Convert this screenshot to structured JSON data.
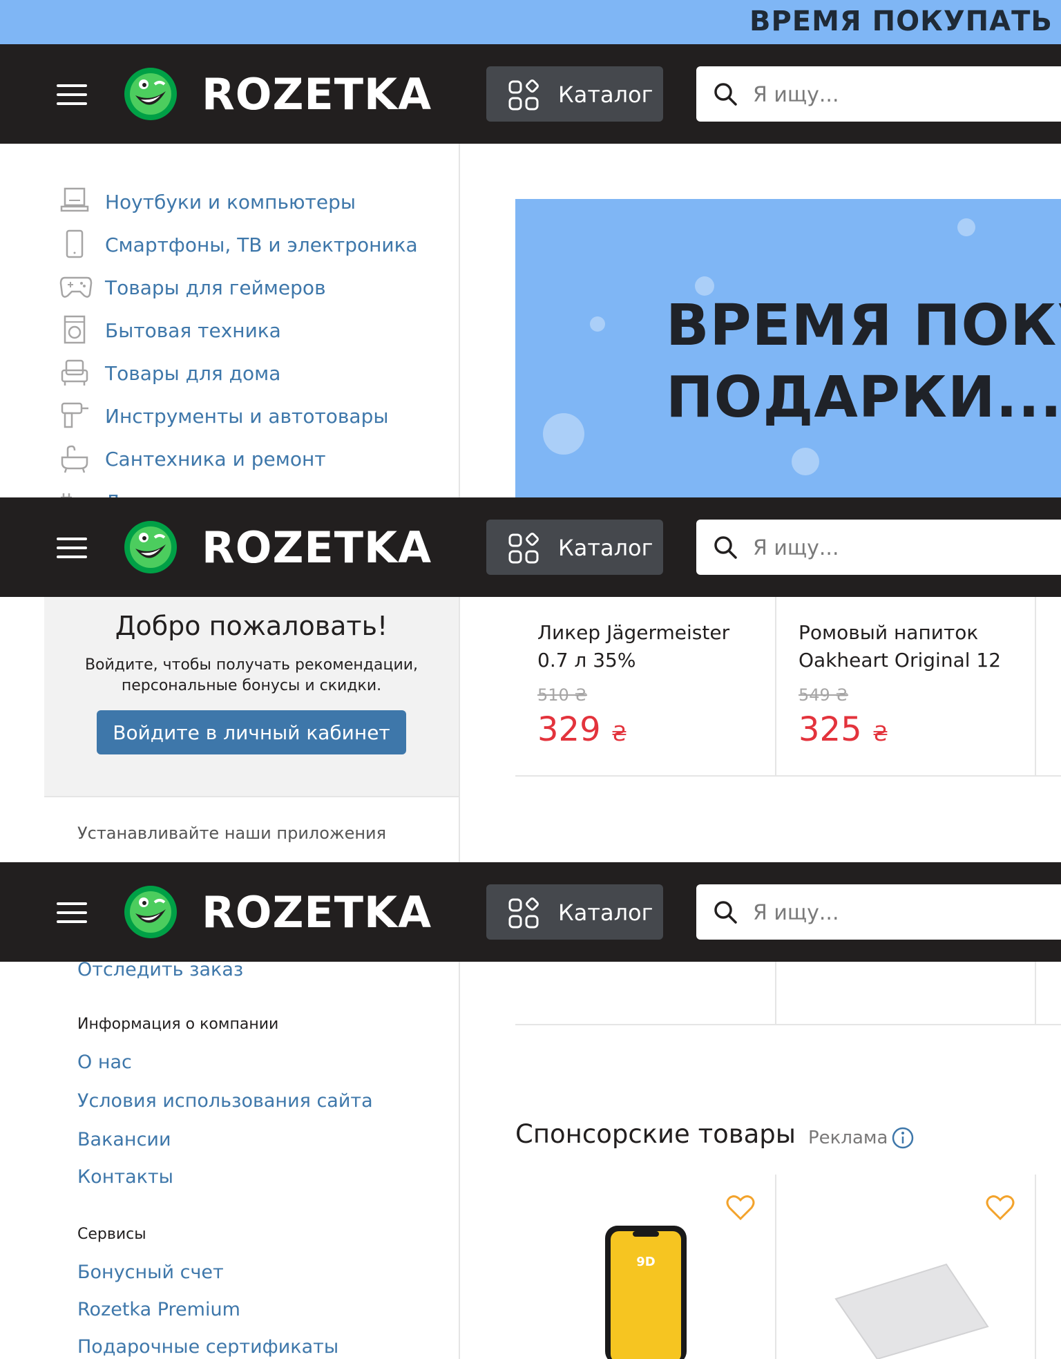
{
  "promo_strip": {
    "text": "ВРЕМЯ ПОКУПАТЬ П"
  },
  "header": {
    "logo_text": "ROZETKA",
    "catalog_label": "Каталог",
    "search_placeholder": "Я ищу..."
  },
  "categories": [
    {
      "label": "Ноутбуки и компьютеры",
      "icon": "laptop-icon"
    },
    {
      "label": "Смартфоны, ТВ и электроника",
      "icon": "smartphone-icon"
    },
    {
      "label": "Товары для геймеров",
      "icon": "gamepad-icon"
    },
    {
      "label": "Бытовая техника",
      "icon": "washing-machine-icon"
    },
    {
      "label": "Товары для дома",
      "icon": "armchair-icon"
    },
    {
      "label": "Инструменты и автотовары",
      "icon": "drill-icon"
    },
    {
      "label": "Сантехника и ремонт",
      "icon": "bathtub-icon"
    },
    {
      "label": "Дача, сад и огород",
      "icon": "garden-icon"
    }
  ],
  "banner": {
    "line1": "ВРЕМЯ ПОКУ",
    "line2": "ПОДАРКИ..."
  },
  "welcome": {
    "title": "Добро пожаловать!",
    "text": "Войдите, чтобы получать рекомендации, персональные бонусы и скидки.",
    "button": "Войдите в личный кабинет"
  },
  "apps_label": "Устанавливайте наши приложения",
  "products": [
    {
      "name": "Ликер Jägermeister 0.7 л 35%",
      "old_price": "510 ₴",
      "price": "329",
      "currency": "₴"
    },
    {
      "name": "Ромовый напиток Oakheart Original 12",
      "old_price": "549 ₴",
      "price": "325",
      "currency": "₴"
    }
  ],
  "footer": {
    "track_order": "Отследить заказ",
    "company_heading": "Информация о компании",
    "company_links": [
      "О нас",
      "Условия использования сайта",
      "Вакансии",
      "Контакты"
    ],
    "services_heading": "Сервисы",
    "services_links": [
      "Бонусный счет",
      "Rozetka Premium",
      "Подарочные сертификаты"
    ]
  },
  "sponsored": {
    "title": "Спонсорские товары",
    "ad_label": "Реклама",
    "phone_glass_badge": "9D"
  },
  "colors": {
    "header_bg": "#221f1f",
    "link": "#3e77aa",
    "price_red": "#e3333c",
    "logo_green": "#00a046",
    "heart": "#f3a32c",
    "promo_blue": "#7fb6f5"
  }
}
